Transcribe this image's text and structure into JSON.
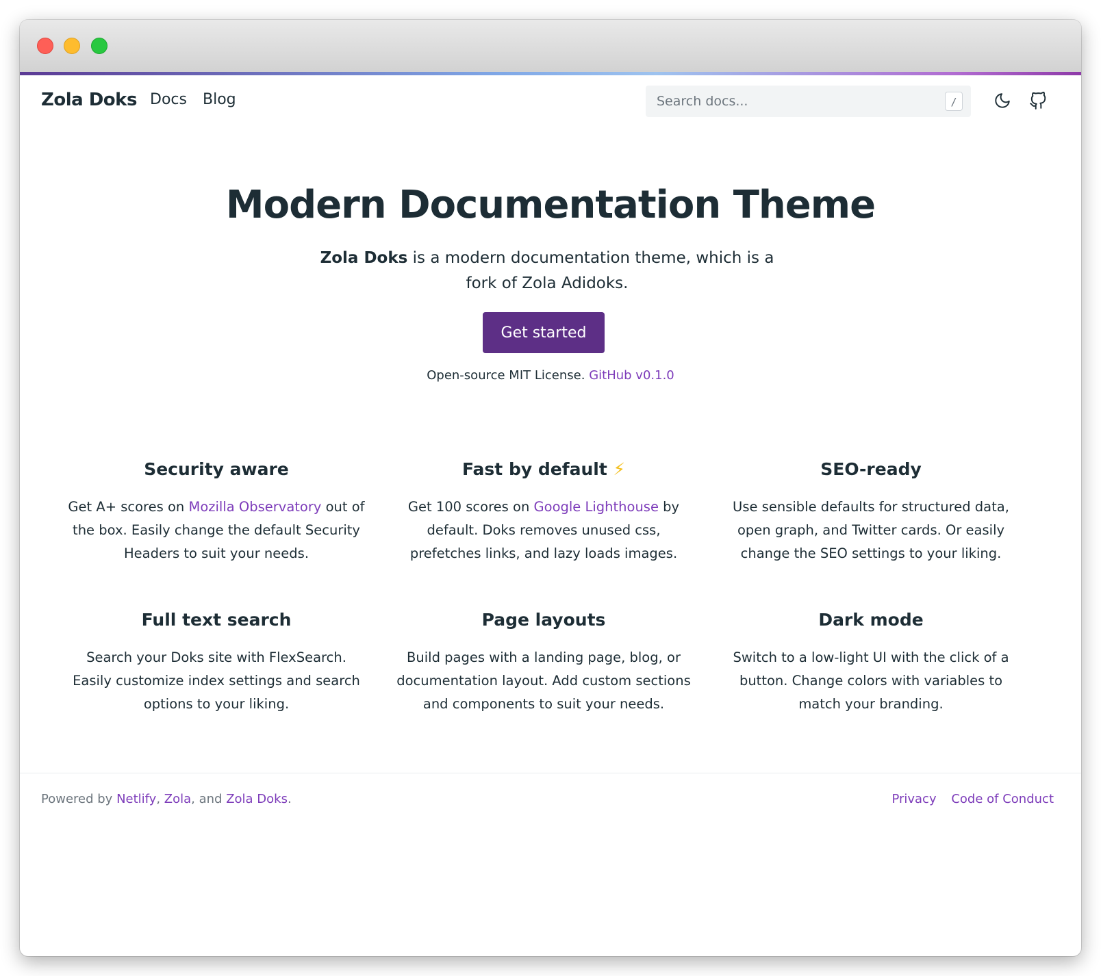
{
  "window": {
    "accent_gradient": [
      "#5b3a94",
      "#9ec3ef",
      "#8e3aa8"
    ]
  },
  "navbar": {
    "brand": "Zola Doks",
    "links": [
      "Docs",
      "Blog"
    ],
    "search_placeholder": "Search docs...",
    "search_shortcut": "/",
    "icons": [
      "moon-icon",
      "github-icon"
    ]
  },
  "hero": {
    "title": "Modern Documentation Theme",
    "lead_brand": "Zola Doks",
    "lead_rest": " is a modern documentation theme, which is a fork of Zola Adidoks.",
    "cta_label": "Get started",
    "license_text": "Open-source MIT License.",
    "github_link": "GitHub v0.1.0"
  },
  "features": [
    {
      "title": "Security aware",
      "pre": "Get A+ scores on ",
      "link": "Mozilla Observatory",
      "post": " out of the box. Easily change the default Security Headers to suit your needs."
    },
    {
      "title": "Fast by default",
      "title_emoji": "⚡",
      "pre": "Get 100 scores on ",
      "link": "Google Lighthouse",
      "post": " by default. Doks removes unused css, prefetches links, and lazy loads images."
    },
    {
      "title": "SEO-ready",
      "text": "Use sensible defaults for structured data, open graph, and Twitter cards. Or easily change the SEO settings to your liking."
    },
    {
      "title": "Full text search",
      "text": "Search your Doks site with FlexSearch. Easily customize index settings and search options to your liking."
    },
    {
      "title": "Page layouts",
      "text": "Build pages with a landing page, blog, or documentation layout. Add custom sections and components to suit your needs."
    },
    {
      "title": "Dark mode",
      "text": "Switch to a low-light UI with the click of a button. Change colors with variables to match your branding."
    }
  ],
  "footer": {
    "powered_by": "Powered by ",
    "netlify": "Netlify",
    "sep1": ", ",
    "zola": "Zola",
    "sep2": ", and ",
    "zola_doks": "Zola Doks",
    "end": ".",
    "privacy": "Privacy",
    "code_of_conduct": "Code of Conduct"
  },
  "colors": {
    "primary": "#5d2f86",
    "link": "#7d3cba",
    "text": "#1d2d35",
    "muted": "#6c757d"
  }
}
